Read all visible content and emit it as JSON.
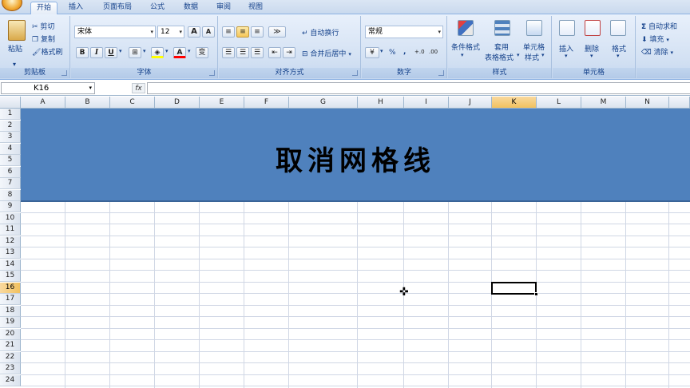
{
  "tabs": [
    {
      "label": "开始",
      "active": true
    },
    {
      "label": "插入",
      "active": false
    },
    {
      "label": "页面布局",
      "active": false
    },
    {
      "label": "公式",
      "active": false
    },
    {
      "label": "数据",
      "active": false
    },
    {
      "label": "审阅",
      "active": false
    },
    {
      "label": "视图",
      "active": false
    }
  ],
  "clipboard": {
    "paste_label": "粘贴",
    "cut_label": "剪切",
    "copy_label": "复制",
    "format_painter_label": "格式刷",
    "group_label": "剪贴板"
  },
  "font": {
    "font_name": "宋体",
    "font_size": "12",
    "grow_label": "A",
    "shrink_label": "A",
    "bold_label": "B",
    "italic_label": "I",
    "underline_label": "U",
    "font_color_label": "A",
    "phonetic_label": "变",
    "group_label": "字体"
  },
  "alignment": {
    "wrap_label": "自动换行",
    "merge_label": "合并后居中",
    "group_label": "对齐方式"
  },
  "number": {
    "format_value": "常规",
    "percent_label": "%",
    "comma_label": ",",
    "inc_decimal_label": "+.0",
    "dec_decimal_label": ".00",
    "group_label": "数字"
  },
  "styles": {
    "conditional_label": "条件格式",
    "table_label_line1": "套用",
    "table_label_line2": "表格格式",
    "cell_styles_line1": "单元格",
    "cell_styles_line2": "样式",
    "group_label": "样式"
  },
  "cells": {
    "insert_label": "插入",
    "delete_label": "删除",
    "format_label": "格式",
    "group_label": "单元格"
  },
  "editing": {
    "autosum_label": "自动求和",
    "fill_label": "填充",
    "clear_label": "清除",
    "sigma": "Σ"
  },
  "formula_bar": {
    "name_box": "K16",
    "fx_label": "fx",
    "value": ""
  },
  "sheet": {
    "columns": [
      "A",
      "B",
      "C",
      "D",
      "E",
      "F",
      "G",
      "H",
      "I",
      "J",
      "K",
      "L",
      "M",
      "N"
    ],
    "rows": [
      "1",
      "2",
      "3",
      "4",
      "5",
      "6",
      "7",
      "8",
      "9",
      "10",
      "11",
      "12",
      "13",
      "14",
      "15",
      "16",
      "17",
      "18",
      "19",
      "20",
      "21",
      "22",
      "23",
      "24"
    ],
    "selected_column": "K",
    "selected_row": "16",
    "banner_title": "取消网格线",
    "banner_color": "#4f81bd"
  }
}
